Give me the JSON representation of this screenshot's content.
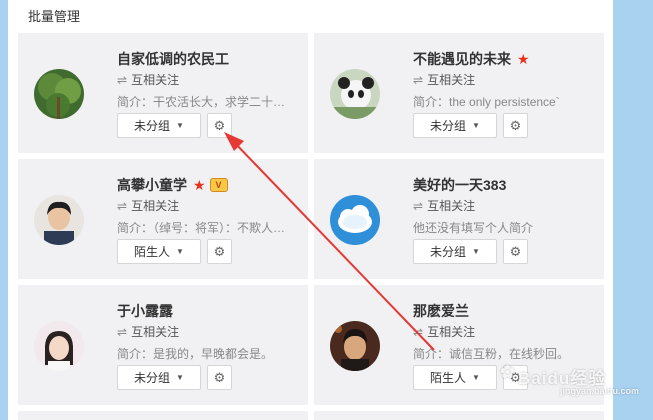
{
  "header": {
    "batch_label": "批量管理"
  },
  "cards": [
    {
      "name": "自家低调的农民工",
      "follow": "互相关注",
      "intro": "简介：干农活长大，求学二十余年…",
      "group": "未分组",
      "star": false,
      "vip": false,
      "avatar": "avatar-tree"
    },
    {
      "name": "不能遇见的未来",
      "follow": "互相关注",
      "intro": "简介：the only persistence`",
      "group": "未分组",
      "star": true,
      "vip": false,
      "avatar": "avatar-panda"
    },
    {
      "name": "高攀小童学",
      "follow": "互相关注",
      "intro": "简介：（绰号：将军）：不欺人…",
      "group": "陌生人",
      "star": true,
      "vip": true,
      "avatar": "avatar-boy"
    },
    {
      "name": "美好的一天383",
      "follow": "互相关注",
      "intro": "他还没有填写个人简介",
      "group": "未分组",
      "star": false,
      "vip": false,
      "avatar": "avatar-cloud"
    },
    {
      "name": "于小露露",
      "follow": "互相关注",
      "intro": "简介：是我的，早晚都会是。",
      "group": "未分组",
      "star": false,
      "vip": false,
      "avatar": "avatar-girl"
    },
    {
      "name": "那麽爱兰",
      "follow": "互相关注",
      "intro": "简介：诚信互粉，在线秒回。",
      "group": "陌生人",
      "star": false,
      "vip": false,
      "avatar": "avatar-man"
    }
  ],
  "icons": {
    "follow": "mutual-follow-icon",
    "gear": "gear-icon",
    "caret": "caret-down-icon",
    "star": "red-star-icon",
    "vip": "vip-badge-icon"
  },
  "colors": {
    "background": "#a9d1f0",
    "card": "#f1f1f4",
    "star": "#e8321e",
    "arrow": "#e53935"
  },
  "watermark": {
    "brand": "Baidu经验",
    "url": "jingyan.baidu.com"
  }
}
